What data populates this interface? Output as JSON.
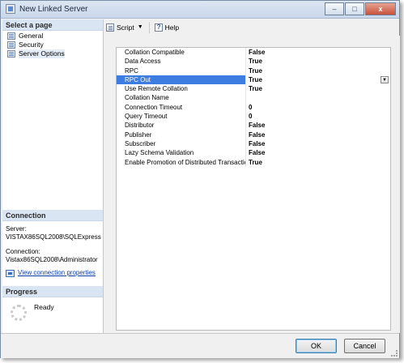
{
  "window": {
    "title": "New Linked Server",
    "controls": {
      "minimize": "–",
      "maximize": "□",
      "close": "x"
    }
  },
  "left": {
    "select_page_header": "Select a page",
    "pages": [
      {
        "label": "General",
        "icon": "page-icon"
      },
      {
        "label": "Security",
        "icon": "page-icon"
      },
      {
        "label": "Server Options",
        "icon": "page-icon",
        "selected": true
      }
    ],
    "connection": {
      "header": "Connection",
      "server_label": "Server:",
      "server_value": "VISTAX86SQL2008\\SQLExpress",
      "connection_label": "Connection:",
      "connection_value": "Vistax86SQL2008\\Administrator",
      "link": "View connection properties"
    },
    "progress": {
      "header": "Progress",
      "status": "Ready"
    }
  },
  "toolbar": {
    "script_label": "Script",
    "help_label": "Help",
    "dropdown_glyph": "▼"
  },
  "options": [
    {
      "name": "Collation Compatible",
      "value": "False"
    },
    {
      "name": "Data Access",
      "value": "True"
    },
    {
      "name": "RPC",
      "value": "True"
    },
    {
      "name": "RPC Out",
      "value": "True",
      "selected": true
    },
    {
      "name": "Use Remote Collation",
      "value": "True"
    },
    {
      "name": "Collation Name",
      "value": ""
    },
    {
      "name": "Connection Timeout",
      "value": "0"
    },
    {
      "name": "Query Timeout",
      "value": "0"
    },
    {
      "name": "Distributor",
      "value": "False"
    },
    {
      "name": "Publisher",
      "value": "False"
    },
    {
      "name": "Subscriber",
      "value": "False"
    },
    {
      "name": "Lazy Schema Validation",
      "value": "False"
    },
    {
      "name": "Enable Promotion of Distributed Transactions",
      "value": "True"
    }
  ],
  "buttons": {
    "ok": "OK",
    "cancel": "Cancel"
  },
  "colors": {
    "selection": "#3d7de1",
    "header_bg": "#d9e5f3",
    "link": "#0b3ea8"
  }
}
